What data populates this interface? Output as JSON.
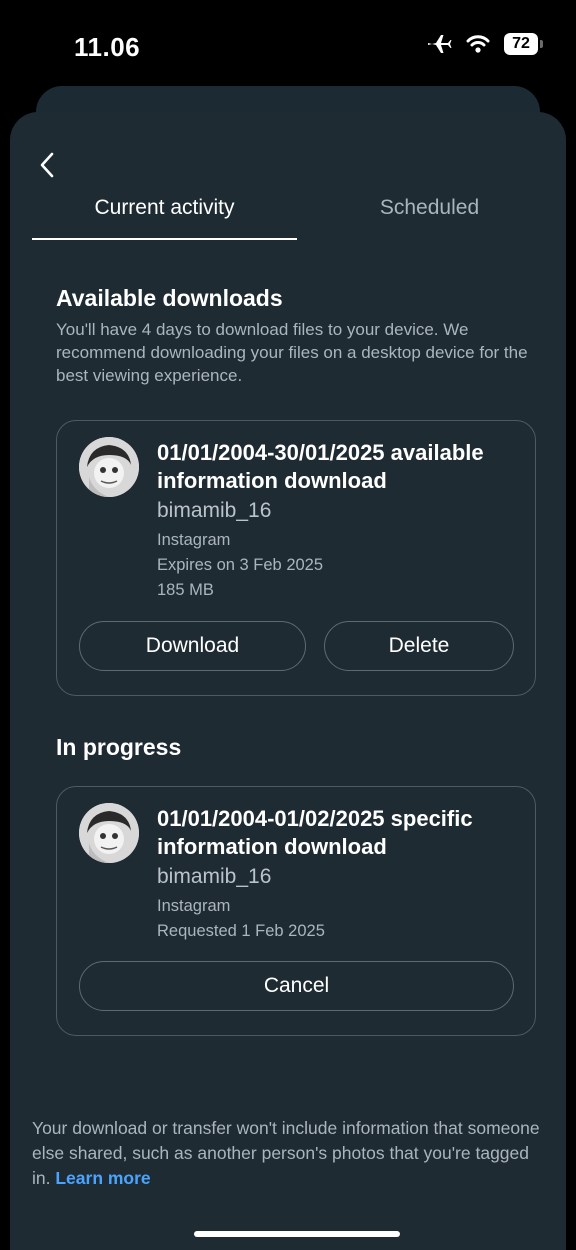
{
  "status_bar": {
    "time": "11.06",
    "battery": "72"
  },
  "tabs": [
    {
      "label": "Current activity",
      "active": true
    },
    {
      "label": "Scheduled",
      "active": false
    }
  ],
  "available": {
    "title": "Available downloads",
    "description": "You'll have 4 days to download files to your device. We recommend downloading your files on a desktop device for the best viewing experience.",
    "card": {
      "title": "01/01/2004-30/01/2025 available information download",
      "username": "bimamib_16",
      "platform": "Instagram",
      "expires": "Expires on 3 Feb 2025",
      "size": "185 MB",
      "download_label": "Download",
      "delete_label": "Delete"
    }
  },
  "in_progress": {
    "title": "In progress",
    "card": {
      "title": "01/01/2004-01/02/2025 specific information download",
      "username": "bimamib_16",
      "platform": "Instagram",
      "requested": "Requested 1 Feb 2025",
      "cancel_label": "Cancel"
    }
  },
  "footer": {
    "text": "Your download or transfer won't include information that someone else shared, such as another person's photos that you're tagged in. ",
    "link": "Learn more"
  },
  "colors": {
    "background": "#1f2b33",
    "link": "#4aa4ff",
    "border": "#4c5a63"
  }
}
